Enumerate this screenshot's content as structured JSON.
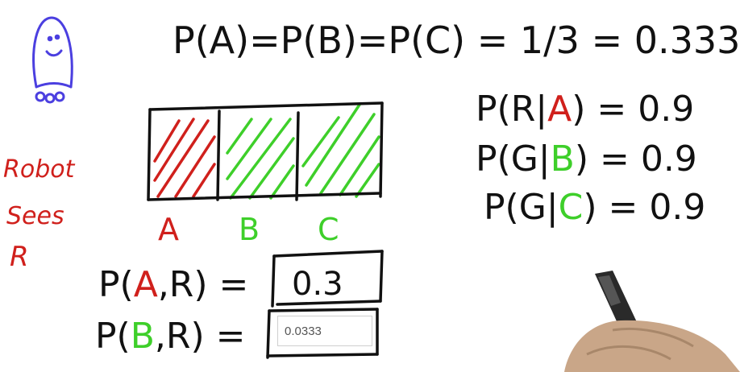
{
  "colors": {
    "ink": "#111111",
    "red": "#d0201c",
    "green": "#3ecf2a",
    "blue": "#4b3fe0"
  },
  "top_equation": "P(A)=P(B)=P(C) = 1/3 = 0.333",
  "robot_label": [
    "Robot",
    "Sees",
    "R"
  ],
  "cells": [
    "A",
    "B",
    "C"
  ],
  "likelihoods": [
    {
      "prefix": "P(R|",
      "cell": "A",
      "suffix": ") = 0.9"
    },
    {
      "prefix": "P(G|",
      "cell": "B",
      "suffix": ") = 0.9"
    },
    {
      "prefix": "P(G|",
      "cell": "C",
      "suffix": ") = 0.9"
    }
  ],
  "joint_a": {
    "prefix": "P(",
    "cell": "A",
    "suffix": ",R) =",
    "answer": "0.3"
  },
  "joint_b": {
    "prefix": "P(",
    "cell": "B",
    "suffix": ",R) =",
    "input_value": "0.0333"
  }
}
